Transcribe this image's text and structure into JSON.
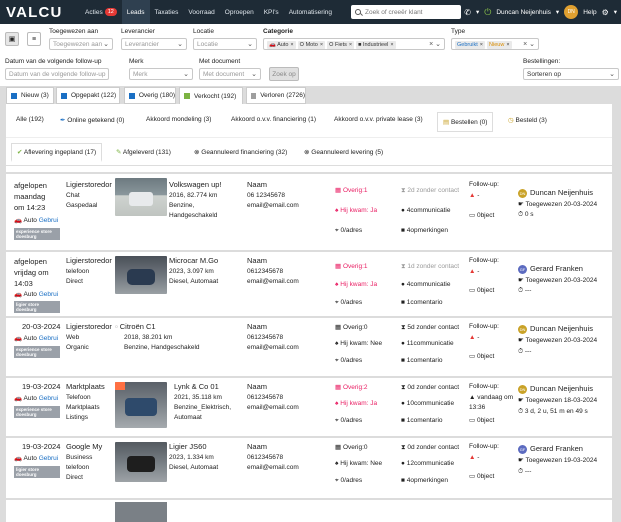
{
  "nav": {
    "logo": "VALCU",
    "links": [
      {
        "label": "Acties",
        "badge": "12"
      },
      {
        "label": "Leads",
        "active": true
      },
      {
        "label": "Taxaties"
      },
      {
        "label": "Voorraad"
      },
      {
        "label": "Oproepen"
      },
      {
        "label": "KPI's"
      },
      {
        "label": "Automatisering"
      }
    ],
    "search_placeholder": "Zoek of creeër klant",
    "user": "Duncan Neijenhuis",
    "avatar_initials": "DN",
    "help": "Help"
  },
  "filters": {
    "toegewezen_label": "Toegewezen aan",
    "toegewezen_placeholder": "Toegewezen aan",
    "leverancier_label": "Leverancier",
    "leverancier_placeholder": "Leverancier",
    "locatie_label": "Locatie",
    "locatie_placeholder": "Locatie",
    "categorie_label": "Categorie",
    "categorie_tags": [
      "Auto",
      "Moto",
      "Fiets",
      "Industrieel"
    ],
    "type_label": "Type",
    "type_tags": [
      {
        "label": "Gebruikt",
        "color": "#1a6fc4"
      },
      {
        "label": "Nieuw",
        "color": "#d98c00"
      }
    ],
    "followup_label": "Datum van de volgende follow-up",
    "followup_placeholder": "Datum van de volgende follow-up",
    "merk_label": "Merk",
    "merk_placeholder": "Merk",
    "document_label": "Met document",
    "document_placeholder": "Met document",
    "zoek_button": "Zoek op",
    "bestellingen_label": "Bestellingen:",
    "sort_value": "Sorteren op"
  },
  "status_tabs": [
    {
      "label": "Nieuw (3)",
      "color": "#1a6fc4"
    },
    {
      "label": "Opgepakt (122)",
      "color": "#1a6fc4"
    },
    {
      "label": "Overig (180)",
      "color": "#1a6fc4"
    },
    {
      "label": "Verkocht (192)",
      "color": "#7cb342",
      "active": true
    },
    {
      "label": "Verloren (2726)",
      "color": "#9e9e9e"
    }
  ],
  "sub_tabs": [
    "Alle (192)",
    "Online getekend (0)",
    "Akkoord mondeling (3)",
    "Akkoord o.v.v. financiering (1)",
    "Akkoord o.v.v. private lease (3)",
    "Bestellen (0)",
    "Besteld (3)"
  ],
  "sub_tabs2": [
    "Aflevering ingepland (17)",
    "Afgeleverd (131)",
    "Geannuleerd financiering (32)",
    "Geannuleerd levering (5)"
  ],
  "leads": [
    {
      "date_lines": [
        "afgelopen",
        "maandag",
        "om 14:23"
      ],
      "source": "Ligierstoredor",
      "channel1": "Chat",
      "channel2": "Gaspedaal",
      "type": "Auto",
      "condition": "Gebrui",
      "store": "experience store doesburg",
      "car_title": "Volkswagen up!",
      "car_info1": "2016, 82.774 km",
      "car_info2": "Benzine,",
      "car_info3": "Handgeschakeld",
      "name": "Naam",
      "phone": "06 12345678",
      "email": "email@email.com",
      "overig": "Overig:1",
      "hijkwam": "Hij kwam: Ja",
      "adres": "0/adres",
      "contact": "2d zonder contact",
      "comm": "4communicatie",
      "opm": "4opmerkingen",
      "followup_label": "Follow-up:",
      "followup_val": "-",
      "object": "0bject",
      "assignee": "Duncan Neijenhuis",
      "assigned": "Toegewezen 20-03-2024",
      "count": "0 s",
      "assignee_color": "#c9a227"
    },
    {
      "date_lines": [
        "afgelopen",
        "vrijdag om",
        "14:03"
      ],
      "source": "Ligierstoredor",
      "channel1": "telefoon",
      "channel2": "Direct",
      "type": "Auto",
      "condition": "Gebrui",
      "store": "ligier store doesburg",
      "car_title": "Microcar M.Go",
      "car_info1": "2023, 3.097 km",
      "car_info2": "Diesel, Automaat",
      "car_info3": "",
      "name": "Naam",
      "phone": "0612345678",
      "email": "email@email.com",
      "overig": "Overig:1",
      "hijkwam": "Hij kwam: Ja",
      "adres": "0/adres",
      "contact": "1d zonder contact",
      "comm": "4communicatie",
      "opm": "1comentario",
      "followup_label": "Follow-up:",
      "followup_val": "-",
      "object": "0bject",
      "assignee": "Gerard Franken",
      "assigned": "Toegewezen 20-03-2024",
      "count": "---",
      "assignee_color": "#5c6bc0"
    },
    {
      "date_lines": [
        "20-03-2024"
      ],
      "source": "Ligierstoredor",
      "channel1": "Web",
      "channel2": "Organic",
      "type": "Auto",
      "condition": "Gebrui",
      "store": "experience store doesburg",
      "car_title": "Citroën C1",
      "car_info1": "2018, 38.201 km",
      "car_info2": "Benzine, Handgeschakeld",
      "car_info3": "",
      "name": "Naam",
      "phone": "0612345678",
      "email": "email@email.com",
      "overig": "Overig:0",
      "hijkwam": "Hij kwam: Nee",
      "adres": "0/adres",
      "contact": "5d zonder contact",
      "comm": "11communicatie",
      "opm": "1comentario",
      "followup_label": "Follow-up:",
      "followup_val": "-",
      "object": "0bject",
      "assignee": "Duncan Neijenhuis",
      "assigned": "Toegewezen 20-03-2024",
      "count": "---",
      "assignee_color": "#c9a227"
    },
    {
      "date_lines": [
        "19-03-2024"
      ],
      "source": "Marktplaats",
      "channel1": "Telefoon",
      "channel2": "Marktplaats",
      "channel3": "Listings",
      "type": "Auto",
      "condition": "Gebrui",
      "store": "experience store doesburg",
      "car_title": "Lynk & Co 01",
      "car_info1": "2021, 35.118 km",
      "car_info2": "Benzine_Elektrisch,",
      "car_info3": "Automaat",
      "name": "Naam",
      "phone": "0612345678",
      "email": "email@email.com",
      "overig": "Overig:2",
      "hijkwam": "Hij kwam: Ja",
      "adres": "0/adres",
      "contact": "0d zonder contact",
      "comm": "10communicatie",
      "opm": "1comentario",
      "followup_label": "Follow-up:",
      "followup_val": "vandaag om 13:36",
      "object": "0bject",
      "assignee": "Duncan Neijenhuis",
      "assigned": "Toegewezen 18-03-2024",
      "count": "3 d, 2 u, 51 m en 49 s",
      "assignee_color": "#c9a227"
    },
    {
      "date_lines": [
        "19-03-2024"
      ],
      "source": "Google My",
      "channel1": "Business",
      "channel2": "telefoon",
      "channel3": "Direct",
      "type": "Auto",
      "condition": "Gebrui",
      "store": "ligier store doesburg",
      "car_title": "Ligier JS60",
      "car_info1": "2023, 1.334 km",
      "car_info2": "Diesel, Automaat",
      "car_info3": "",
      "name": "Naam",
      "phone": "0612345678",
      "email": "email@email.com",
      "overig": "Overig:0",
      "hijkwam": "Hij kwam: Nee",
      "adres": "0/adres",
      "contact": "0d zonder contact",
      "comm": "12communicatie",
      "opm": "4opmerkingen",
      "followup_label": "Follow-up:",
      "followup_val": "-",
      "object": "0bject",
      "assignee": "Gerard Franken",
      "assigned": "Toegewezen 19-03-2024",
      "count": "---",
      "assignee_color": "#5c6bc0"
    }
  ]
}
